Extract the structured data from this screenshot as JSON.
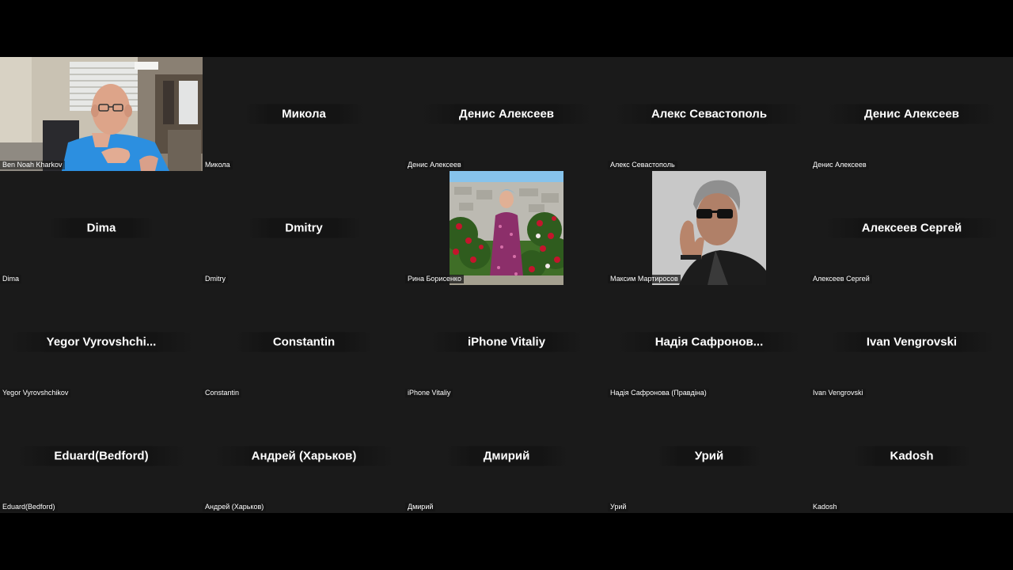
{
  "participants": [
    {
      "display": "",
      "tag": "Ben Noah Kharkov",
      "video": "self-video"
    },
    {
      "display": "Микола",
      "tag": "Микола"
    },
    {
      "display": "Денис Алексеев",
      "tag": "Денис Алексеев"
    },
    {
      "display": "Алекс Севастополь",
      "tag": "Алекс Севастополь"
    },
    {
      "display": "Денис Алексеев",
      "tag": "Денис Алексеев"
    },
    {
      "display": "Dima",
      "tag": "Dima"
    },
    {
      "display": "Dmitry",
      "tag": "Dmitry"
    },
    {
      "display": "",
      "tag": "Рина Борисенко",
      "video": "garden-photo"
    },
    {
      "display": "",
      "tag": "Максим Мартиросов",
      "video": "portrait-photo"
    },
    {
      "display": "Алексеев Сергей",
      "tag": "Алексеев Сергей"
    },
    {
      "display": "Yegor  Vyrovshchi...",
      "tag": "Yegor Vyrovshchikov"
    },
    {
      "display": "Constantin",
      "tag": "Constantin"
    },
    {
      "display": "iPhone Vitaliy",
      "tag": "iPhone Vitaliy"
    },
    {
      "display": "Надія  Сафронов...",
      "tag": "Надія Сафронова (Правдіна)"
    },
    {
      "display": "Ivan Vengrovski",
      "tag": "Ivan Vengrovski"
    },
    {
      "display": "Eduard(Bedford)",
      "tag": "Eduard(Bedford)"
    },
    {
      "display": "Андрей (Харьков)",
      "tag": "Андрей (Харьков)"
    },
    {
      "display": "Дмирий",
      "tag": "Дмирий"
    },
    {
      "display": "Урий",
      "tag": "Урий"
    },
    {
      "display": "Kadosh",
      "tag": "Kadosh"
    }
  ],
  "colors": {
    "background": "#000000",
    "tile": "#1a1a1a",
    "text": "#ffffff"
  }
}
